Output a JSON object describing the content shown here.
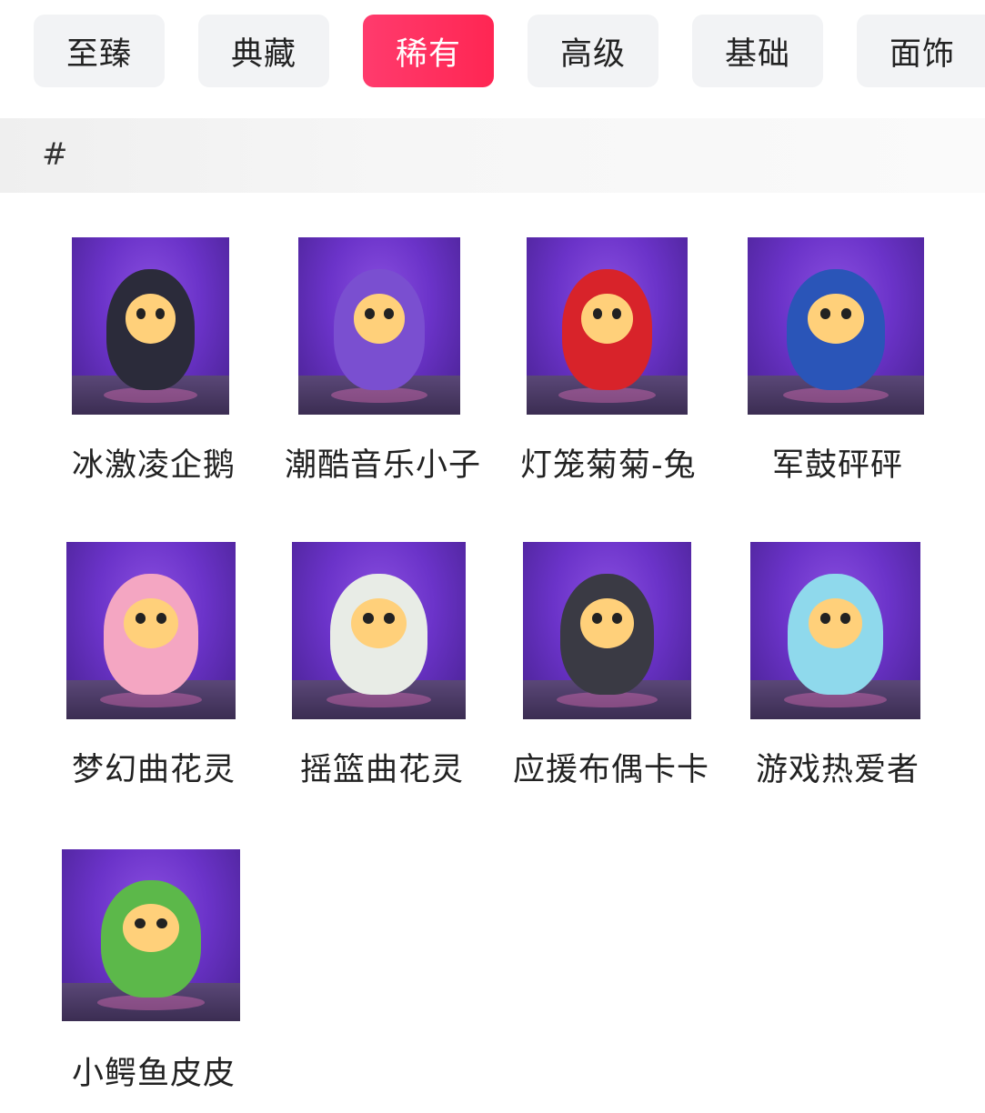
{
  "tabs": [
    {
      "label": "至臻",
      "active": false
    },
    {
      "label": "典藏",
      "active": false
    },
    {
      "label": "稀有",
      "active": true
    },
    {
      "label": "高级",
      "active": false
    },
    {
      "label": "基础",
      "active": false
    },
    {
      "label": "面饰",
      "active": false
    }
  ],
  "section": {
    "label": "#"
  },
  "items": [
    {
      "name": "冰激凌企鹅",
      "color": "#2b2b3a"
    },
    {
      "name": "潮酷音乐小子",
      "color": "#7a4fd0"
    },
    {
      "name": "灯笼菊菊-兔",
      "color": "#d8232a"
    },
    {
      "name": "军鼓砰砰",
      "color": "#2a55b8"
    },
    {
      "name": "梦幻曲花灵",
      "color": "#f4a6c2"
    },
    {
      "name": "摇篮曲花灵",
      "color": "#e8ece6"
    },
    {
      "name": "应援布偶卡卡",
      "color": "#3a3a44"
    },
    {
      "name": "游戏热爱者",
      "color": "#8fd9ec"
    },
    {
      "name": "小鳄鱼皮皮",
      "color": "#5cb84a"
    }
  ],
  "colors": {
    "accent": "#ff2d5e",
    "tab_bg": "#f2f3f5",
    "section_bg": "#f0f0f0"
  }
}
